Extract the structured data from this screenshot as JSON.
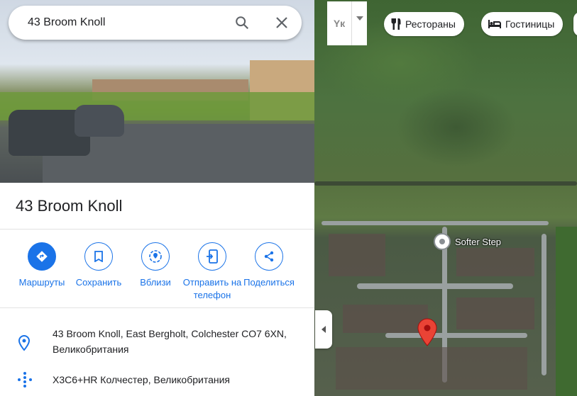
{
  "search": {
    "query": "43 Broom Knoll"
  },
  "place": {
    "title": "43 Broom Knoll"
  },
  "actions": [
    {
      "label": "Маршруты",
      "icon": "directions-icon"
    },
    {
      "label": "Сохранить",
      "icon": "bookmark-icon"
    },
    {
      "label": "Вблизи",
      "icon": "nearby-icon"
    },
    {
      "label": "Отправить на телефон",
      "icon": "send-to-phone-icon"
    },
    {
      "label": "Поделиться",
      "icon": "share-icon"
    }
  ],
  "info": {
    "address": "43 Broom Knoll, East Bergholt, Colchester CO7 6XN, Великобритания",
    "plus_code": "X3C6+HR Колчестер, Великобритания"
  },
  "map": {
    "layer_label": "Yк",
    "chips": [
      {
        "label": "Рестораны",
        "icon": "restaurant-icon"
      },
      {
        "label": "Гостиницы",
        "icon": "hotel-icon"
      }
    ],
    "poi": "Softer Step"
  },
  "colors": {
    "accent": "#1a73e8",
    "pin": "#ea4335"
  }
}
